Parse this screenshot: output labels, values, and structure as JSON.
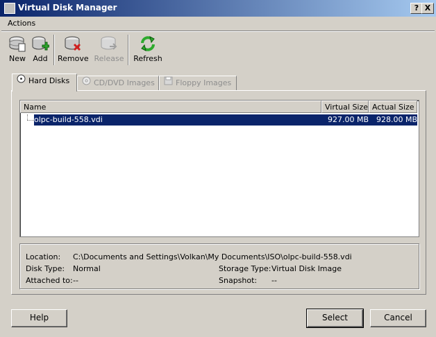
{
  "window": {
    "title": "Virtual Disk Manager",
    "help_btn": "?",
    "close_btn": "X"
  },
  "menu": {
    "actions": "Actions"
  },
  "toolbar": {
    "new": "New",
    "add": "Add",
    "remove": "Remove",
    "release": "Release",
    "refresh": "Refresh"
  },
  "tabs": [
    {
      "label": "Hard Disks"
    },
    {
      "label": "CD/DVD Images"
    },
    {
      "label": "Floppy Images"
    }
  ],
  "list": {
    "columns": [
      "Name",
      "Virtual Size",
      "Actual Size"
    ],
    "rows": [
      {
        "name": "olpc-build-558.vdi",
        "virtual_size": "927.00 MB",
        "actual_size": "928.00 MB"
      }
    ]
  },
  "details": {
    "location_label": "Location:",
    "location_value": "C:\\Documents and Settings\\Volkan\\My Documents\\ISO\\olpc-build-558.vdi",
    "disk_type_label": "Disk Type:",
    "disk_type_value": "Normal",
    "storage_type_label": "Storage Type:",
    "storage_type_value": "Virtual Disk Image",
    "attached_to_label": "Attached to:",
    "attached_to_value": "--",
    "snapshot_label": "Snapshot:",
    "snapshot_value": "--"
  },
  "buttons": {
    "help": "Help",
    "select": "Select",
    "cancel": "Cancel"
  },
  "colors": {
    "selection": "#0a246a",
    "titlebar_start": "#0a246a",
    "face": "#d4d0c8"
  }
}
